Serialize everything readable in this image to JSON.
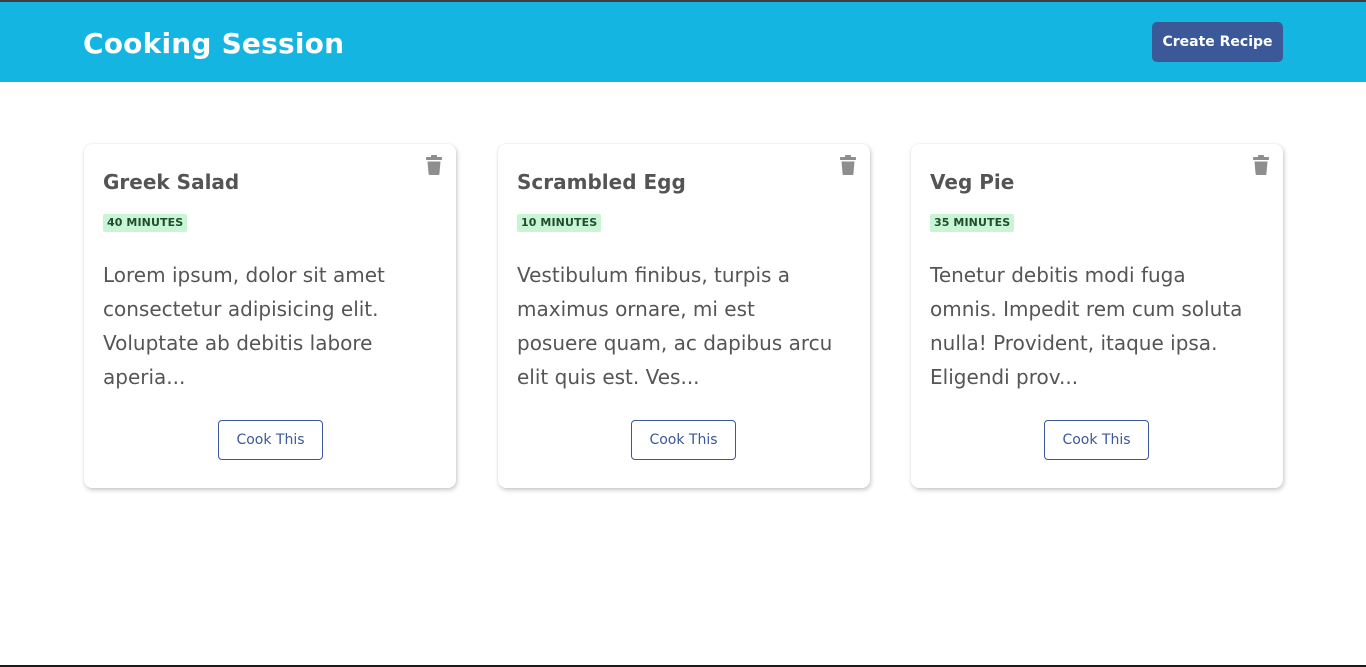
{
  "header": {
    "title": "Cooking Session",
    "create_label": "Create Recipe"
  },
  "recipes": [
    {
      "title": "Greek Salad",
      "time": "40 MINUTES",
      "description": "Lorem ipsum, dolor sit amet consectetur adipisicing elit. Voluptate ab debitis labore aperia...",
      "action_label": "Cook This",
      "delete_icon": "trash-icon"
    },
    {
      "title": "Scrambled Egg",
      "time": "10 MINUTES",
      "description": "Vestibulum finibus, turpis a maximus ornare, mi est posuere quam, ac dapibus arcu elit quis est. Ves...",
      "action_label": "Cook This",
      "delete_icon": "trash-icon"
    },
    {
      "title": "Veg Pie",
      "time": "35 MINUTES",
      "description": "Tenetur debitis modi fuga omnis. Impedit rem cum soluta nulla! Provident, itaque ipsa. Eligendi prov...",
      "action_label": "Cook This",
      "delete_icon": "trash-icon"
    }
  ],
  "colors": {
    "header_bg": "#14b5e0",
    "primary": "#3b5898",
    "badge_bg": "#c8f5d3",
    "text": "#555555",
    "icon": "#8e8e8e"
  }
}
